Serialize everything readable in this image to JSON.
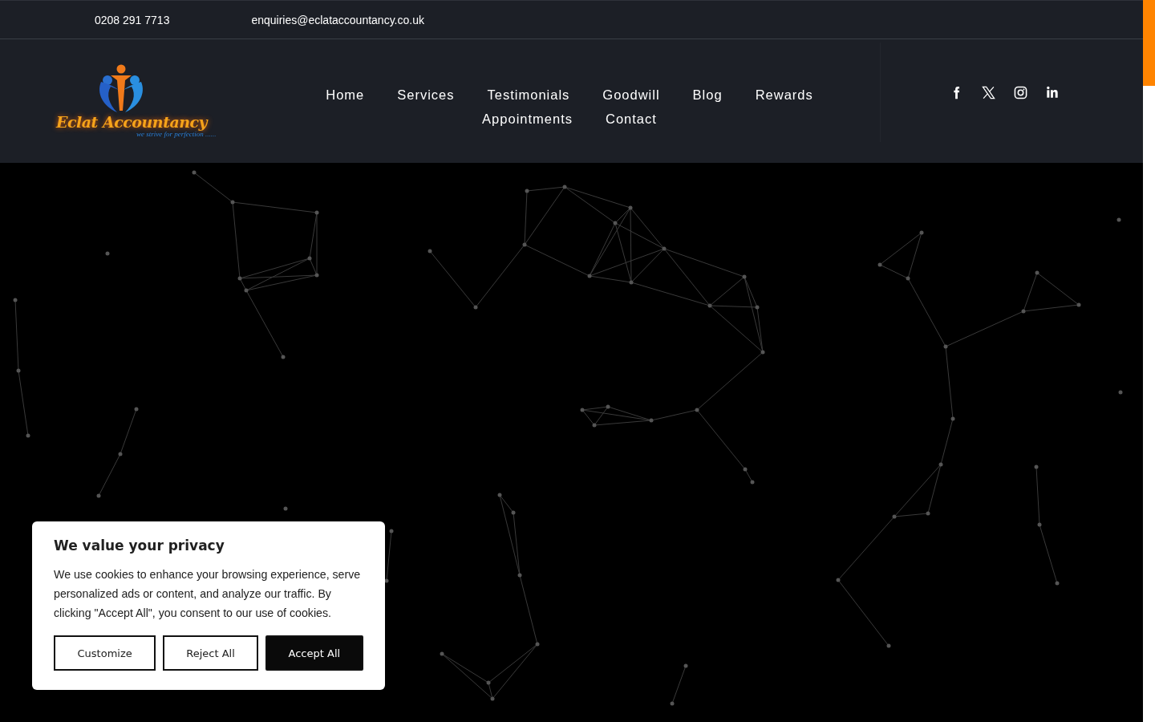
{
  "top_bar": {
    "phone": "0208 291 7713",
    "email": "enquiries@eclataccountancy.co.uk"
  },
  "logo": {
    "name": "Eclat Accountancy",
    "tagline": "we strive for perfection ......"
  },
  "nav": {
    "items": [
      {
        "label": "Home"
      },
      {
        "label": "Services"
      },
      {
        "label": "Testimonials"
      },
      {
        "label": "Goodwill"
      },
      {
        "label": "Blog"
      },
      {
        "label": "Rewards"
      },
      {
        "label": "Appointments"
      },
      {
        "label": "Contact"
      }
    ]
  },
  "social": [
    {
      "kind": "facebook"
    },
    {
      "kind": "x"
    },
    {
      "kind": "instagram"
    },
    {
      "kind": "linkedin"
    }
  ],
  "cookie_banner": {
    "title": "We value your privacy",
    "text": "We use cookies to enhance your browsing experience, serve personalized ads or content, and analyze our traffic. By clicking \"Accept All\", you consent to our use of cookies.",
    "buttons": [
      {
        "label": "Customize",
        "kind": "outline"
      },
      {
        "label": "Reject All",
        "kind": "outline"
      },
      {
        "label": "Accept All",
        "kind": "filled"
      }
    ]
  }
}
